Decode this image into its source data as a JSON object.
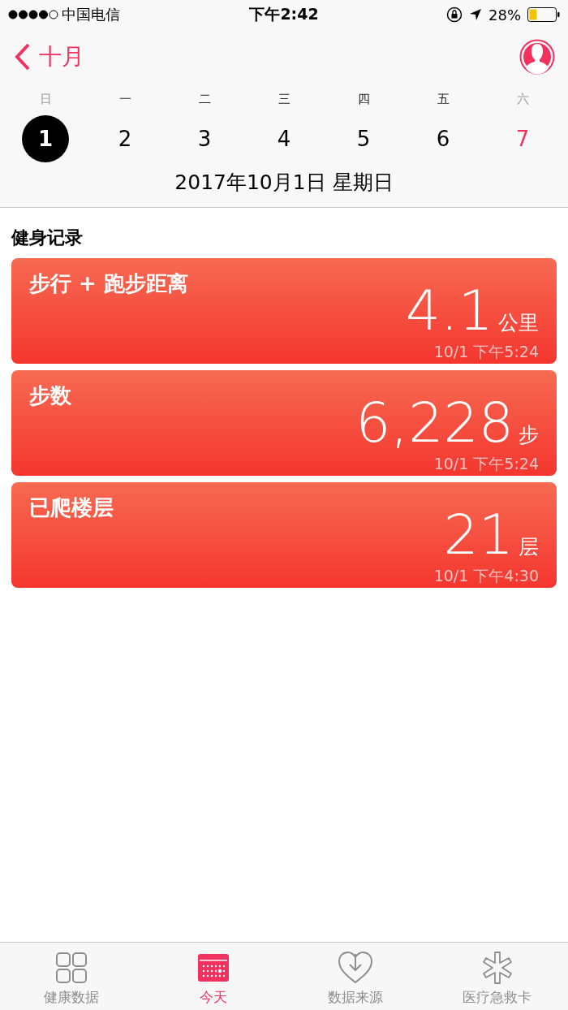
{
  "status_bar": {
    "carrier": "中国电信",
    "time": "下午2:42",
    "battery": "28%"
  },
  "nav": {
    "back": "十月"
  },
  "weekdays": [
    {
      "label": "日",
      "weekend": true
    },
    {
      "label": "一",
      "weekend": false
    },
    {
      "label": "二",
      "weekend": false
    },
    {
      "label": "三",
      "weekend": false
    },
    {
      "label": "四",
      "weekend": false
    },
    {
      "label": "五",
      "weekend": false
    },
    {
      "label": "六",
      "weekend": true
    }
  ],
  "days": [
    {
      "label": "1",
      "selected": true,
      "today": false
    },
    {
      "label": "2",
      "selected": false,
      "today": false
    },
    {
      "label": "3",
      "selected": false,
      "today": false
    },
    {
      "label": "4",
      "selected": false,
      "today": false
    },
    {
      "label": "5",
      "selected": false,
      "today": false
    },
    {
      "label": "6",
      "selected": false,
      "today": false
    },
    {
      "label": "7",
      "selected": false,
      "today": true
    }
  ],
  "date_label": "2017年10月1日 星期日",
  "section_title": "健身记录",
  "cards": [
    {
      "title": "步行 + 跑步距离",
      "value": "4.1",
      "unit": "公里",
      "time": "10/1 下午5:24"
    },
    {
      "title": "步数",
      "value": "6,228",
      "unit": "步",
      "time": "10/1 下午5:24"
    },
    {
      "title": "已爬楼层",
      "value": "21",
      "unit": "层",
      "time": "10/1 下午4:30"
    }
  ],
  "tabs": [
    {
      "label": "健康数据",
      "kind": "grid",
      "selected": false
    },
    {
      "label": "今天",
      "kind": "calendar",
      "selected": true
    },
    {
      "label": "数据来源",
      "kind": "heart",
      "selected": false
    },
    {
      "label": "医疗急救卡",
      "kind": "asterisk",
      "selected": false
    }
  ]
}
